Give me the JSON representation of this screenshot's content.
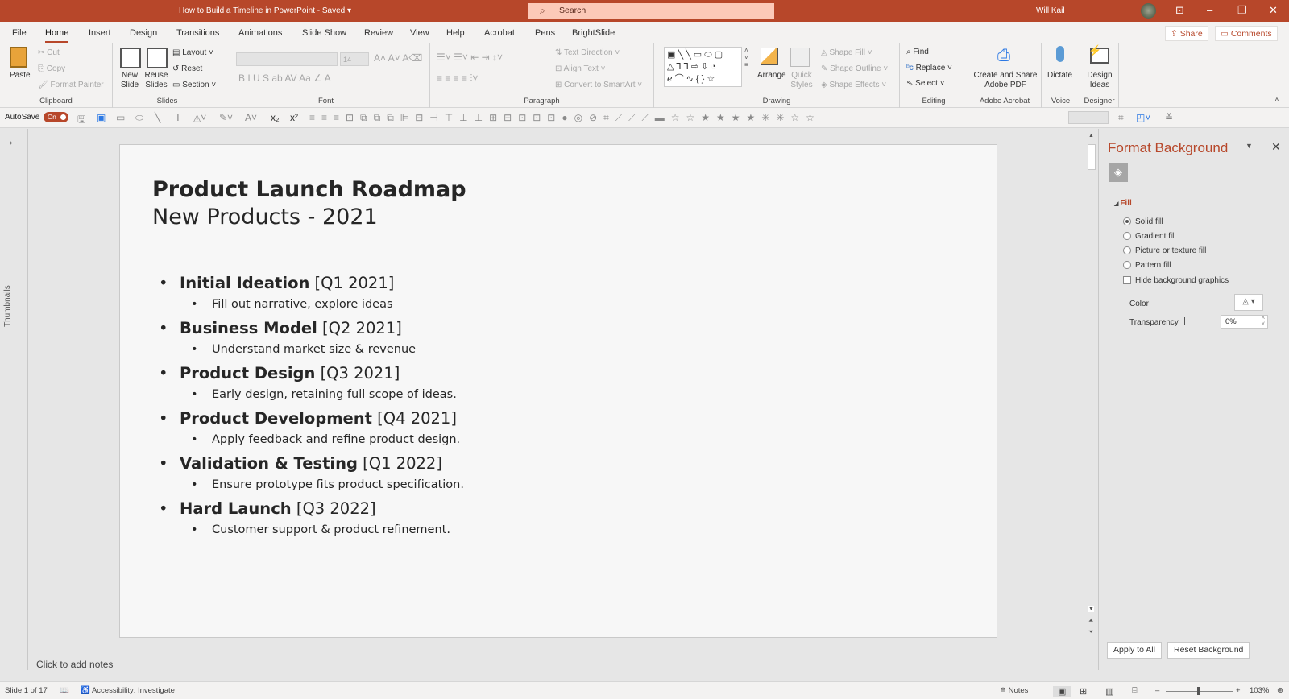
{
  "titlebar": {
    "document_title": "How to Build a Timeline in PowerPoint  -  Saved  ▾",
    "search_placeholder": "Search",
    "user_name": "Will Kail"
  },
  "menu": {
    "tabs": [
      "File",
      "Home",
      "Insert",
      "Design",
      "Transitions",
      "Animations",
      "Slide Show",
      "Review",
      "View",
      "Help",
      "Acrobat",
      "Pens",
      "BrightSlide"
    ],
    "active": "Home",
    "share_label": "Share",
    "comments_label": "Comments"
  },
  "ribbon": {
    "clipboard": {
      "paste": "Paste",
      "cut": "Cut",
      "copy": "Copy",
      "format_painter": "Format Painter",
      "label": "Clipboard"
    },
    "slides": {
      "new_slide": "New Slide",
      "reuse_slides": "Reuse Slides",
      "layout": "Layout",
      "reset": "Reset",
      "section": "Section",
      "label": "Slides"
    },
    "font": {
      "font_name": "",
      "font_size": "14",
      "label": "Font"
    },
    "paragraph": {
      "text_direction": "Text Direction",
      "align_text": "Align Text",
      "convert_smartart": "Convert to SmartArt",
      "label": "Paragraph"
    },
    "drawing": {
      "arrange": "Arrange",
      "quick_styles": "Quick Styles",
      "shape_fill": "Shape Fill",
      "shape_outline": "Shape Outline",
      "shape_effects": "Shape Effects",
      "label": "Drawing"
    },
    "editing": {
      "find": "Find",
      "replace": "Replace",
      "select": "Select",
      "label": "Editing"
    },
    "acrobat": {
      "create_share": "Create and Share Adobe PDF",
      "label": "Adobe Acrobat"
    },
    "voice": {
      "dictate": "Dictate",
      "label": "Voice"
    },
    "designer": {
      "design_ideas": "Design Ideas",
      "label": "Designer"
    }
  },
  "qat": {
    "autosave_label": "AutoSave",
    "autosave_state": "On"
  },
  "thumbnails_label": "Thumbnails",
  "slide": {
    "title": "Product Launch Roadmap",
    "subtitle": "New Products - 2021",
    "items": [
      {
        "phase": "Initial Ideation",
        "date": "[Q1 2021]",
        "detail": "Fill out narrative, explore ideas"
      },
      {
        "phase": "Business Model",
        "date": "[Q2 2021]",
        "detail": "Understand market size & revenue"
      },
      {
        "phase": "Product Design",
        "date": "[Q3 2021]",
        "detail": "Early design, retaining full scope of ideas."
      },
      {
        "phase": "Product Development",
        "date": "[Q4 2021]",
        "detail": "Apply feedback and refine product design."
      },
      {
        "phase": "Validation & Testing",
        "date": "[Q1 2022]",
        "detail": "Ensure prototype fits product specification."
      },
      {
        "phase": "Hard Launch",
        "date": "[Q3 2022]",
        "detail": "Customer support & product refinement."
      }
    ]
  },
  "notes_placeholder": "Click to add notes",
  "format_panel": {
    "title": "Format Background",
    "section": "Fill",
    "options": [
      "Solid fill",
      "Gradient fill",
      "Picture or texture fill",
      "Pattern fill"
    ],
    "selected": "Solid fill",
    "hide_graphics": "Hide background graphics",
    "color_label": "Color",
    "transparency_label": "Transparency",
    "transparency_value": "0%",
    "apply_all": "Apply to All",
    "reset_bg": "Reset Background"
  },
  "status": {
    "slide_count": "Slide 1 of 17",
    "accessibility": "Accessibility: Investigate",
    "notes": "Notes",
    "zoom": "103%"
  },
  "colors": {
    "accent": "#b7472a"
  }
}
